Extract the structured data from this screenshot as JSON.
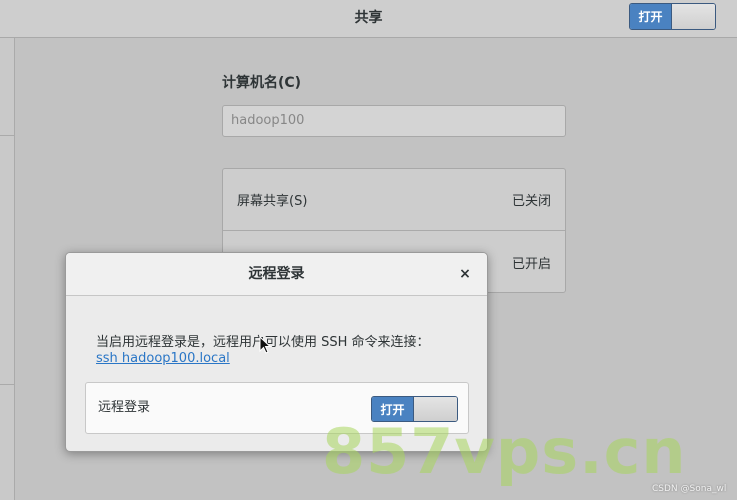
{
  "header": {
    "title": "共享",
    "toggle_label": "打开"
  },
  "computer_name": {
    "label": "计算机名(C)",
    "value": "hadoop100"
  },
  "services": [
    {
      "label": "屏幕共享(S)",
      "status": "已关闭"
    },
    {
      "label": "",
      "status": "已开启"
    }
  ],
  "dialog": {
    "title": "远程登录",
    "close_glyph": "×",
    "description": "当启用远程登录是，远程用户可以使用 SSH 命令来连接：",
    "link": "ssh hadoop100.local",
    "row_label": "远程登录",
    "toggle_label": "打开"
  },
  "watermark": {
    "text": "857vps.cn",
    "credit": "CSDN @Sona_wl"
  },
  "colors": {
    "accent": "#4a82c1",
    "link": "#2a76c6",
    "watermark": "#a8d65c"
  }
}
